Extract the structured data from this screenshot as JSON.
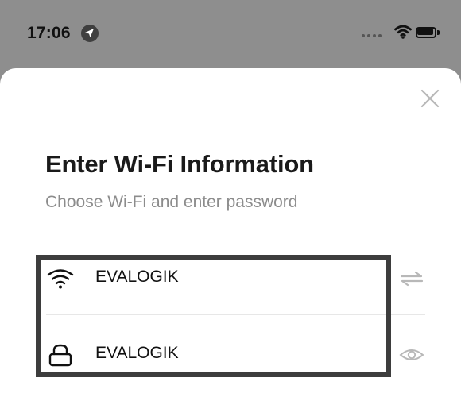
{
  "status_bar": {
    "time": "17:06"
  },
  "dialog": {
    "title": "Enter Wi-Fi Information",
    "subtitle": "Choose Wi-Fi and enter password"
  },
  "wifi_row": {
    "icon": "wifi-icon",
    "value": "EVALOGIK",
    "action_icon": "swap-arrows-icon"
  },
  "password_row": {
    "icon": "lock-icon",
    "value": "EVALOGIK",
    "action_icon": "eye-icon"
  },
  "colors": {
    "backdrop": "#8e8e8e",
    "sheet": "#ffffff",
    "title": "#1a1a1a",
    "subtitle": "#8c8c8c",
    "divider": "#e7e7e7",
    "highlight_border": "#3d3d3d",
    "icon_muted": "#b8b8b8"
  }
}
